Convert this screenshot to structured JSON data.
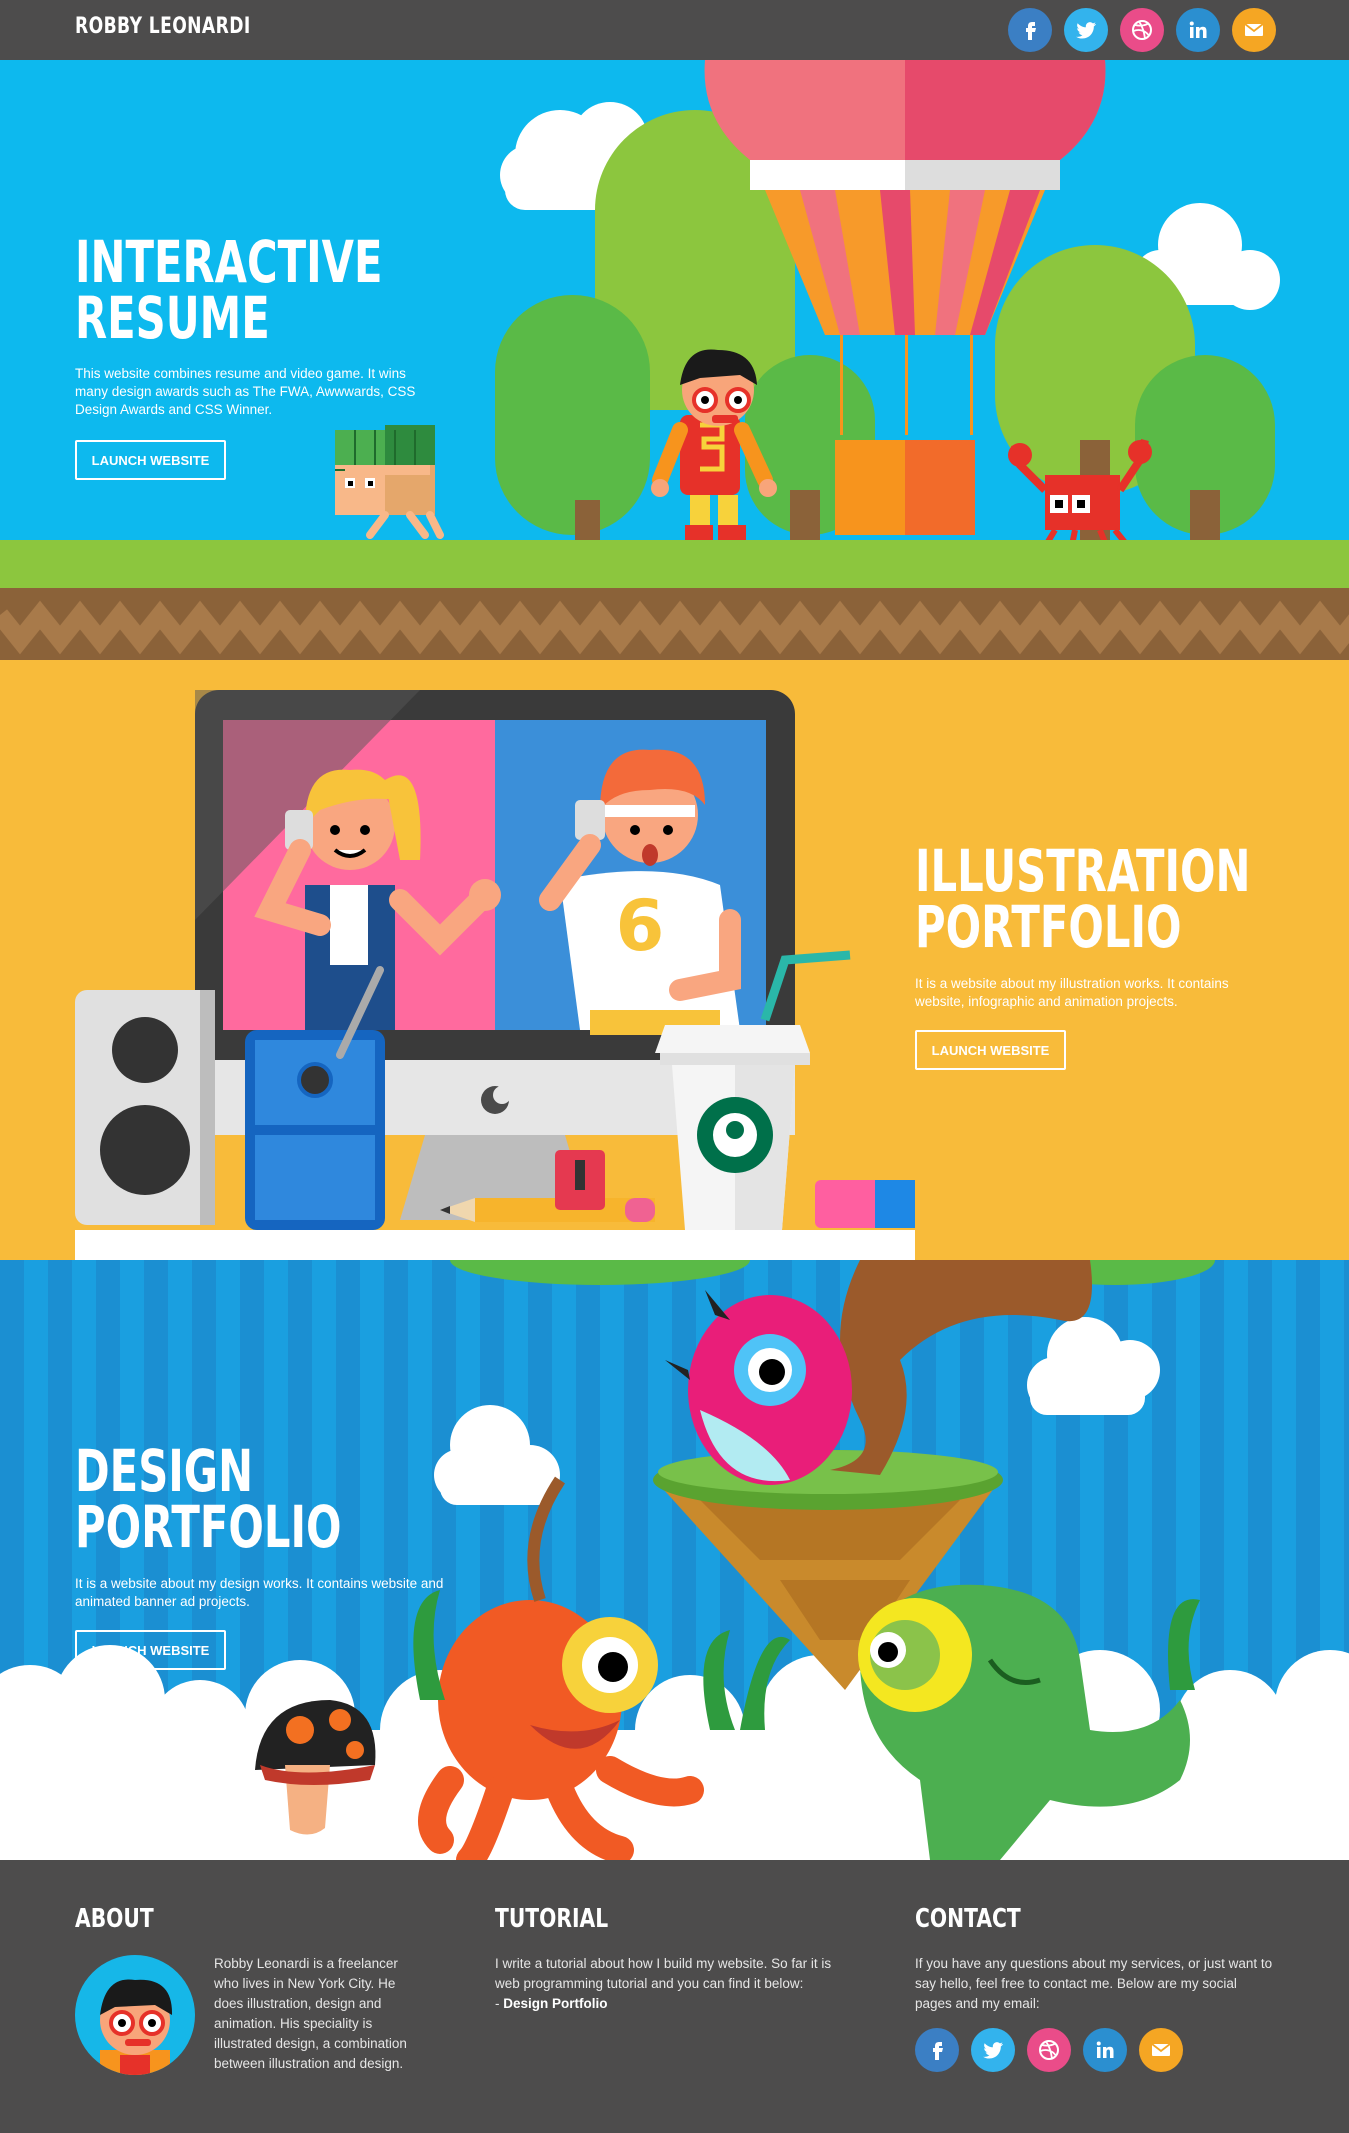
{
  "header": {
    "name": "ROBBY LEONARDI",
    "social": [
      {
        "icon": "facebook-icon",
        "glyph": "f",
        "color": "#3b7fc4"
      },
      {
        "icon": "twitter-icon",
        "glyph": "t",
        "color": "#33b3ed"
      },
      {
        "icon": "dribbble-icon",
        "glyph": "d",
        "color": "#ea4c89"
      },
      {
        "icon": "linkedin-icon",
        "glyph": "in",
        "color": "#2b8fd0"
      },
      {
        "icon": "email-icon",
        "glyph": "m",
        "color": "#f5a623"
      }
    ]
  },
  "sections": {
    "resume": {
      "title_line1": "INTERACTIVE",
      "title_line2": "RESUME",
      "description": "This website combines resume and video game. It wins many design awards such as The FWA, Awwwards, CSS Design Awards and CSS Winner.",
      "button": "LAUNCH WEBSITE"
    },
    "illustration": {
      "title_line1": "ILLUSTRATION",
      "title_line2": "PORTFOLIO",
      "description": "It is a website about my illustration works. It contains website, infographic and animation projects.",
      "button": "LAUNCH WEBSITE",
      "jersey_number": "6"
    },
    "design": {
      "title_line1": "DESIGN",
      "title_line2": "PORTFOLIO",
      "description": "It is a website about my design works. It contains website and animated banner ad projects.",
      "button": "LAUNCH WEBSITE"
    }
  },
  "footer": {
    "about": {
      "title": "ABOUT",
      "text": "Robby Leonardi is a freelancer who lives in New York City. He does illustration, design and animation. His speciality is illustrated design, a combination between illustration and design."
    },
    "tutorial": {
      "title": "TUTORIAL",
      "text": "I write a tutorial about how I build my website. So far it is web programming tutorial and you can find it below:",
      "link_prefix": "- ",
      "link": "Design Portfolio"
    },
    "contact": {
      "title": "CONTACT",
      "text": "If you have any questions about my services, or just want to say hello, feel free to contact me. Below are my social pages and my email:"
    }
  },
  "colors": {
    "header_bg": "#4d4c4c",
    "resume_bg": "#0db9ee",
    "illustration_bg": "#f8bb3a",
    "design_bg": "#1a9fe0",
    "grass": "#8cc63e",
    "dirt": "#8b6239"
  }
}
